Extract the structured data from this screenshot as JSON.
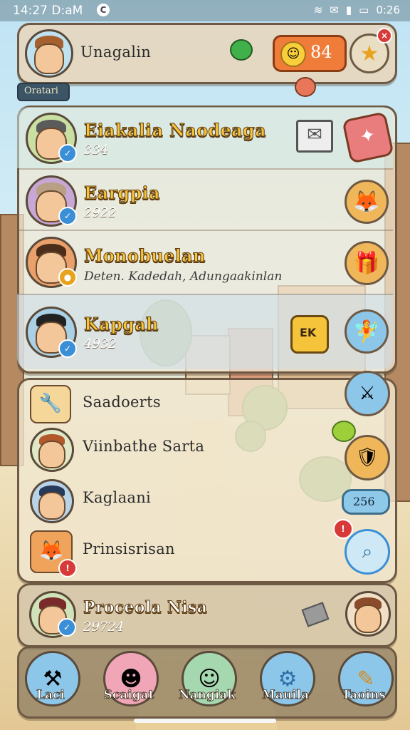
{
  "status_bar": {
    "time": "14:27 D:aM",
    "dot_label": "C",
    "right_time": "0:26"
  },
  "header": {
    "player_name": "Unagalin",
    "level_tag": "Oratari",
    "currency_value": "84",
    "chat_icon": "chat-bubble-icon",
    "close_badge": "×"
  },
  "list_top": [
    {
      "name": "Eiakalia Naodeaga",
      "sub": "334",
      "action_icon": "envelope-icon"
    },
    {
      "name": "Eargpia",
      "sub": "2922",
      "action_icon": "fox-icon"
    },
    {
      "name": "Monobuelan",
      "sub": "Deten. Kadedah, Adungaakinlan",
      "action_icon": "gift-icon"
    },
    {
      "name": "Kapgah",
      "sub": "4932",
      "action_icon": "fairy-icon",
      "tag": "EK"
    }
  ],
  "list_menu": [
    {
      "label": "Saadoerts"
    },
    {
      "label": "Viinbathe Sarta"
    },
    {
      "label": "Kaglaani"
    },
    {
      "label": "Prinsisrisan"
    }
  ],
  "menu_side": {
    "count_pill": "256"
  },
  "featured": {
    "name": "Proceola Nisa",
    "sub": "29724"
  },
  "bottom_nav": [
    {
      "label": "Laci",
      "icon": "tools-icon"
    },
    {
      "label": "Scaigat",
      "icon": "character-icon"
    },
    {
      "label": "Nangiak",
      "icon": "character-icon"
    },
    {
      "label": "Mauila",
      "icon": "gear-icon"
    },
    {
      "label": "Taoins",
      "icon": "ticket-icon"
    }
  ],
  "colors": {
    "panel_border": "#6e5a44",
    "accent_yellow": "#f6c43a",
    "badge_blue": "#3a8fd6",
    "badge_red": "#d83a3a"
  }
}
